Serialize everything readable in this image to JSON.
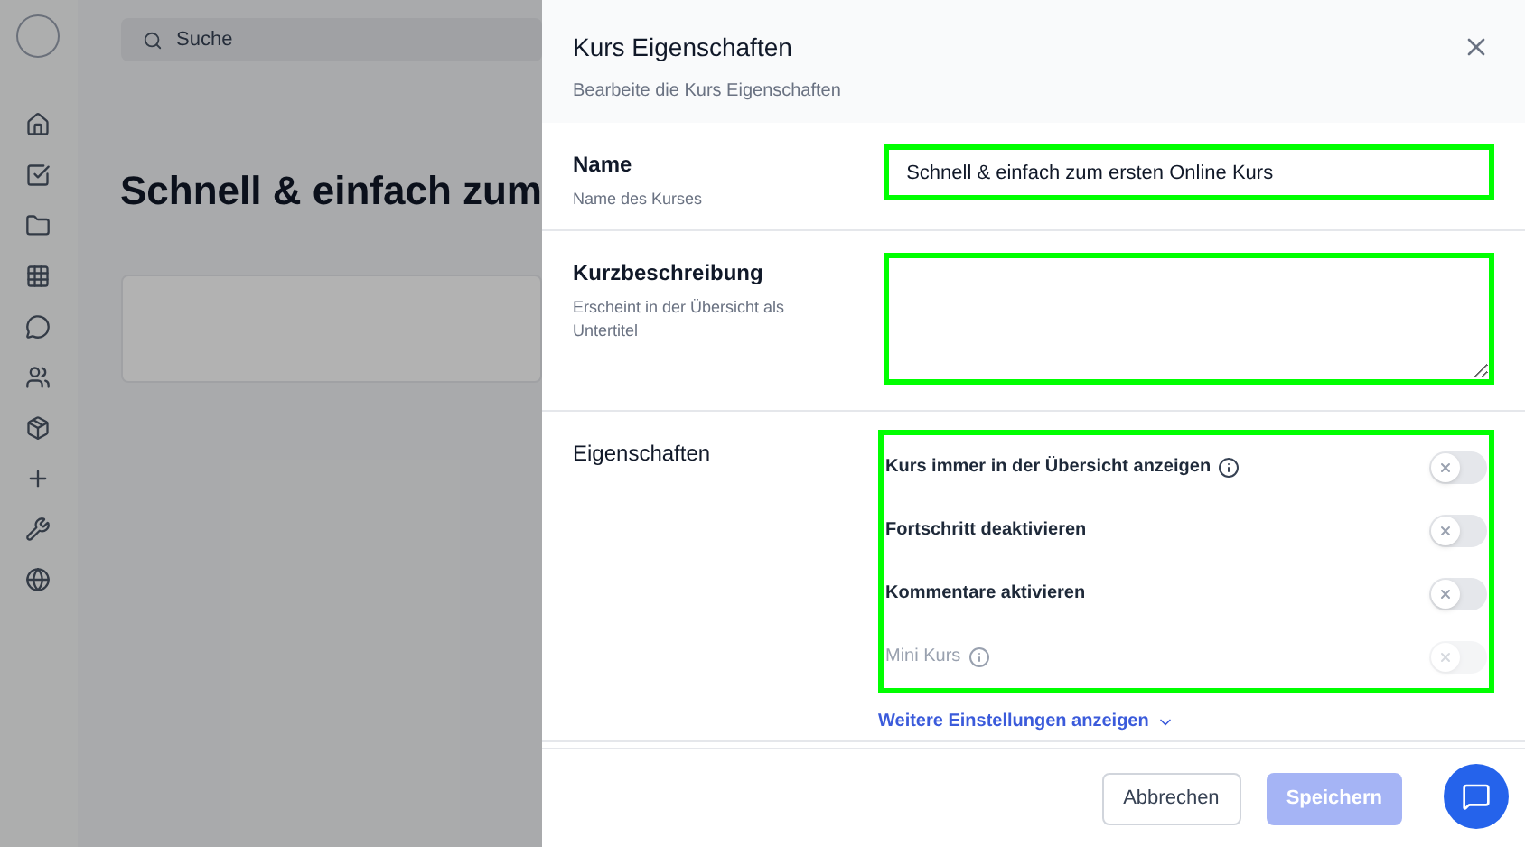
{
  "background": {
    "search": {
      "placeholder": "Suche"
    },
    "heading": "Schnell & einfach zum"
  },
  "panel": {
    "title": "Kurs Eigenschaften",
    "subtitle": "Bearbeite die Kurs Eigenschaften",
    "fields": [
      {
        "kind": "input",
        "label": "Name",
        "hint": "Name des Kurses",
        "value": "Schnell & einfach zum ersten Online Kurs"
      },
      {
        "kind": "textarea",
        "label": "Kurzbeschreibung",
        "hint": "Erscheint in der Übersicht als Untertitel"
      }
    ],
    "properties": {
      "label": "Eigenschaften",
      "toggles": [
        {
          "label": "Kurs immer in der Übersicht anzeigen",
          "info": true,
          "on": false,
          "disabled": false
        },
        {
          "label": "Fortschritt deaktivieren",
          "info": false,
          "on": false,
          "disabled": false
        },
        {
          "label": "Kommentare aktivieren",
          "info": false,
          "on": false,
          "disabled": false
        },
        {
          "label": "Mini Kurs",
          "info": true,
          "on": false,
          "disabled": true
        }
      ],
      "more_link": "Weitere Einstellungen anzeigen"
    },
    "buttons": {
      "cancel": "Abbrechen",
      "save": "Speichern"
    }
  }
}
